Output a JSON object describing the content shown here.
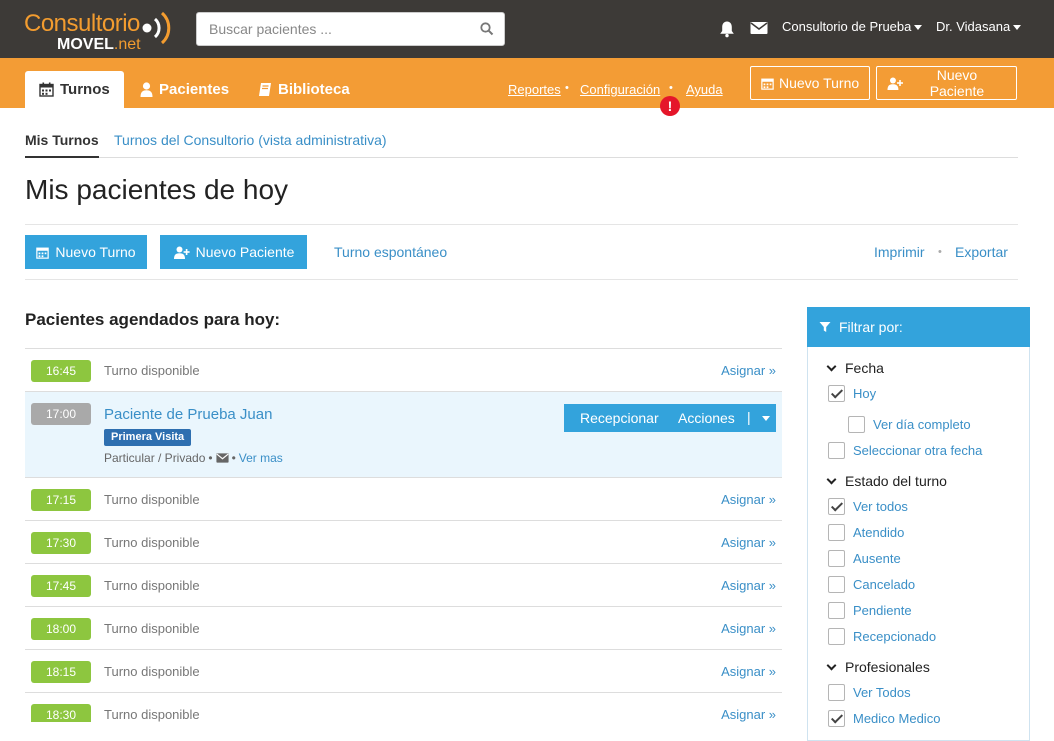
{
  "brand": {
    "logo_main": "Consultorio",
    "logo_sub_a": "MOVEL",
    "logo_sub_b": ".net"
  },
  "search": {
    "placeholder": "Buscar pacientes ..."
  },
  "header": {
    "consultorio": "Consultorio de Prueba",
    "user": "Dr. Vidasana"
  },
  "nav": {
    "tabs": [
      "Turnos",
      "Pacientes",
      "Biblioteca"
    ],
    "links": [
      "Reportes",
      "Configuración",
      "Ayuda"
    ],
    "alert": "!",
    "btn_nuevo_turno": "Nuevo Turno",
    "btn_nuevo_paciente": "Nuevo Paciente"
  },
  "subtabs": {
    "mis_turnos": "Mis Turnos",
    "consultorio": "Turnos del Consultorio (vista administrativa)"
  },
  "page": {
    "title": "Mis pacientes de hoy",
    "btn_nuevo_turno": "Nuevo Turno",
    "btn_nuevo_paciente": "Nuevo Paciente",
    "turno_espontaneo": "Turno espontáneo",
    "imprimir": "Imprimir",
    "exportar": "Exportar",
    "section_title": "Pacientes agendados para hoy:"
  },
  "appointments": [
    {
      "time": "16:45",
      "status": "Turno disponible",
      "action": "Asignar »"
    },
    {
      "time": "17:00",
      "patient": "Paciente de Prueba Juan",
      "badge": "Primera Visita",
      "coverage": "Particular / Privado",
      "more": "Ver mas",
      "recepcionar": "Recepcionar",
      "acciones": "Acciones",
      "pipe": "|"
    },
    {
      "time": "17:15",
      "status": "Turno disponible",
      "action": "Asignar »"
    },
    {
      "time": "17:30",
      "status": "Turno disponible",
      "action": "Asignar »"
    },
    {
      "time": "17:45",
      "status": "Turno disponible",
      "action": "Asignar »"
    },
    {
      "time": "18:00",
      "status": "Turno disponible",
      "action": "Asignar »"
    },
    {
      "time": "18:15",
      "status": "Turno disponible",
      "action": "Asignar »"
    },
    {
      "time": "18:30",
      "status": "Turno disponible",
      "action": "Asignar »"
    }
  ],
  "filter": {
    "title": "Filtrar por:",
    "fecha": "Fecha",
    "hoy": "Hoy",
    "ver_dia": "Ver día completo",
    "otra_fecha": "Seleccionar otra fecha",
    "estado": "Estado del turno",
    "ver_todos": "Ver todos",
    "atendido": "Atendido",
    "ausente": "Ausente",
    "cancelado": "Cancelado",
    "pendiente": "Pendiente",
    "recepcionado": "Recepcionado",
    "profesionales": "Profesionales",
    "ver_todos_prof": "Ver Todos",
    "medico": "Medico Medico"
  },
  "colors": {
    "orange": "#f39c35",
    "dark": "#3d3a37",
    "blue": "#33a3dc",
    "green": "#8dc63f",
    "alert": "#e5162a"
  }
}
